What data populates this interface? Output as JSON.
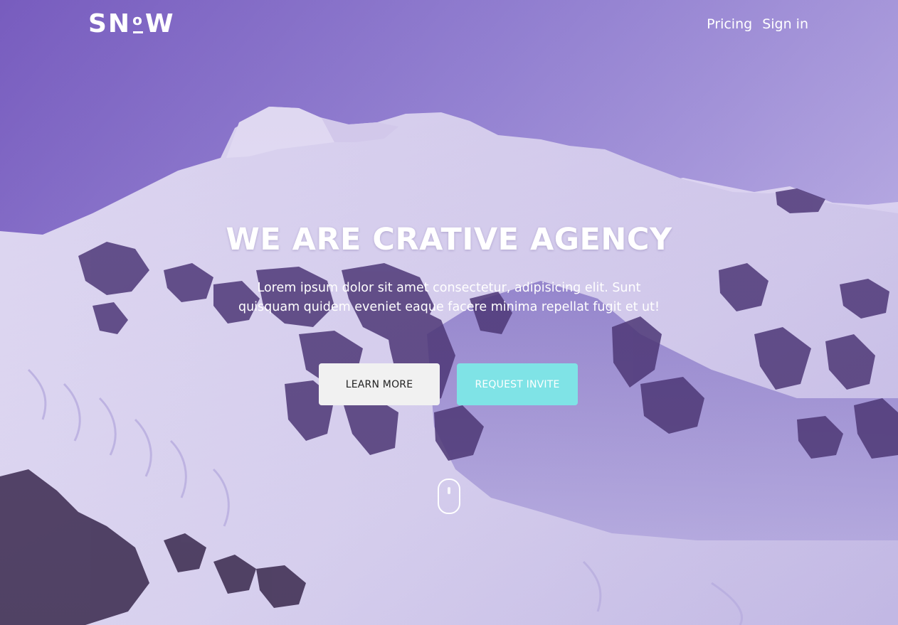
{
  "brand": {
    "logo_left": "SN",
    "logo_o": "o",
    "logo_right": "W"
  },
  "nav": {
    "links": [
      {
        "label": "Pricing"
      },
      {
        "label": "Sign in"
      }
    ]
  },
  "hero": {
    "headline": "WE ARE CRATIVE AGENCY",
    "subtext": "Lorem ipsum dolor sit amet consectetur, adipisicing elit. Sunt quisquam quidem eveniet eaque facere minima repellat fugit et ut!",
    "buttons": {
      "learn_more": "LEARN MORE",
      "request_invite": "REQUEST INVITE"
    },
    "scroll_indicator_icon": "mouse-scroll-icon"
  },
  "colors": {
    "sky_top": "#7d63c2",
    "accent_cyan": "#7fe3e6",
    "snow": "#e6e2f4",
    "rock": "#4b3670"
  }
}
